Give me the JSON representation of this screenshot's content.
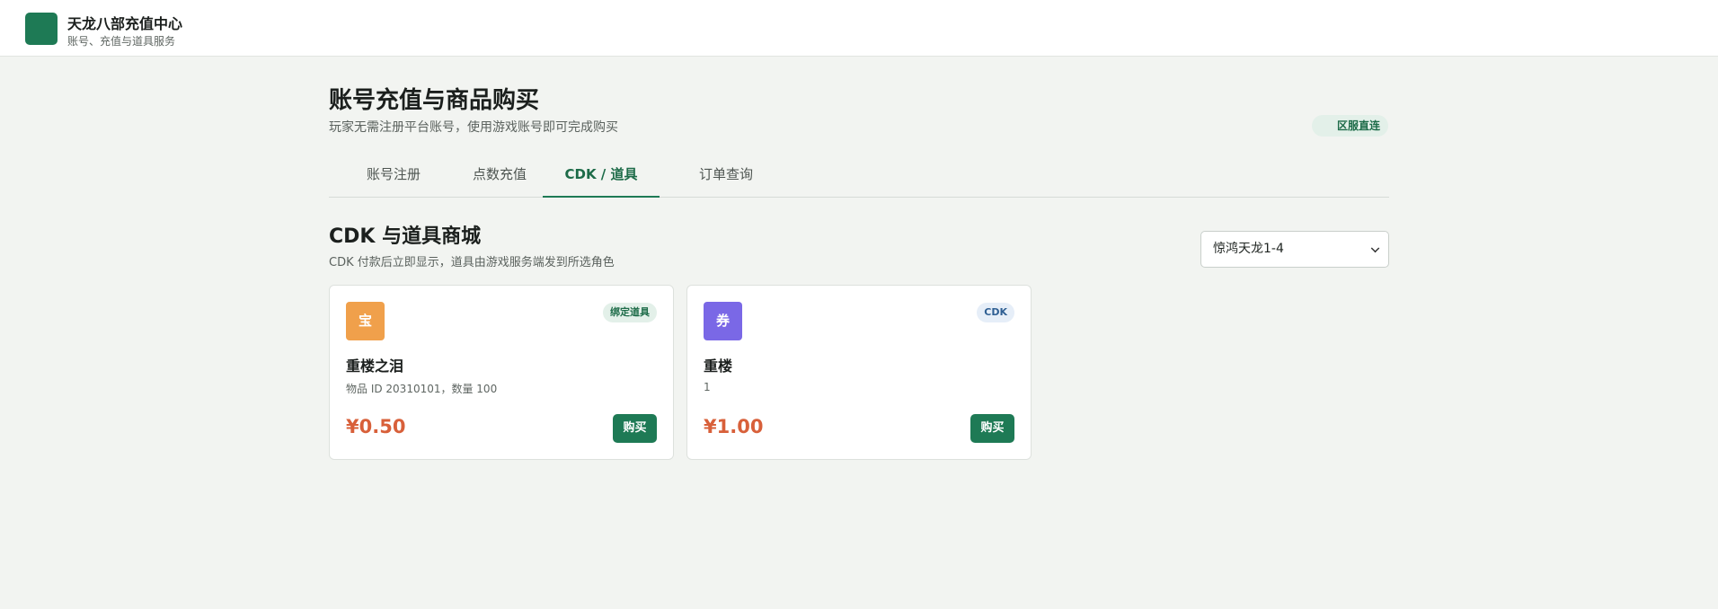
{
  "header": {
    "title": "天龙八部充值中心",
    "subtitle": "账号、充值与道具服务"
  },
  "page": {
    "title": "账号充值与商品购买",
    "subtitle": "玩家无需注册平台账号，使用游戏账号即可完成购买",
    "badge": "区服直连"
  },
  "tabs": [
    {
      "label": "账号注册",
      "active": false
    },
    {
      "label": "点数充值",
      "active": false
    },
    {
      "label": "CDK / 道具",
      "active": true
    },
    {
      "label": "订单查询",
      "active": false
    }
  ],
  "section": {
    "title": "CDK 与道具商城",
    "subtitle": "CDK 付款后立即显示，道具由游戏服务端发到所选角色",
    "server_select_value": "惊鸿天龙1-4"
  },
  "products": [
    {
      "icon_text": "宝",
      "icon_color": "#f0a04b",
      "tag": "绑定道具",
      "tag_bg": "#e3f0e9",
      "tag_color": "#1d6b48",
      "name": "重楼之泪",
      "desc": "物品 ID 20310101，数量 100",
      "price": "¥0.50",
      "buy_label": "购买"
    },
    {
      "icon_text": "券",
      "icon_color": "#7a68e6",
      "tag": "CDK",
      "tag_bg": "#e6eef8",
      "tag_color": "#2f5f93",
      "name": "重楼",
      "desc": "1",
      "price": "¥1.00",
      "buy_label": "购买"
    }
  ],
  "colors": {
    "accent": "#1e7a55",
    "price": "#d8603a",
    "background": "#f2f4f1"
  }
}
